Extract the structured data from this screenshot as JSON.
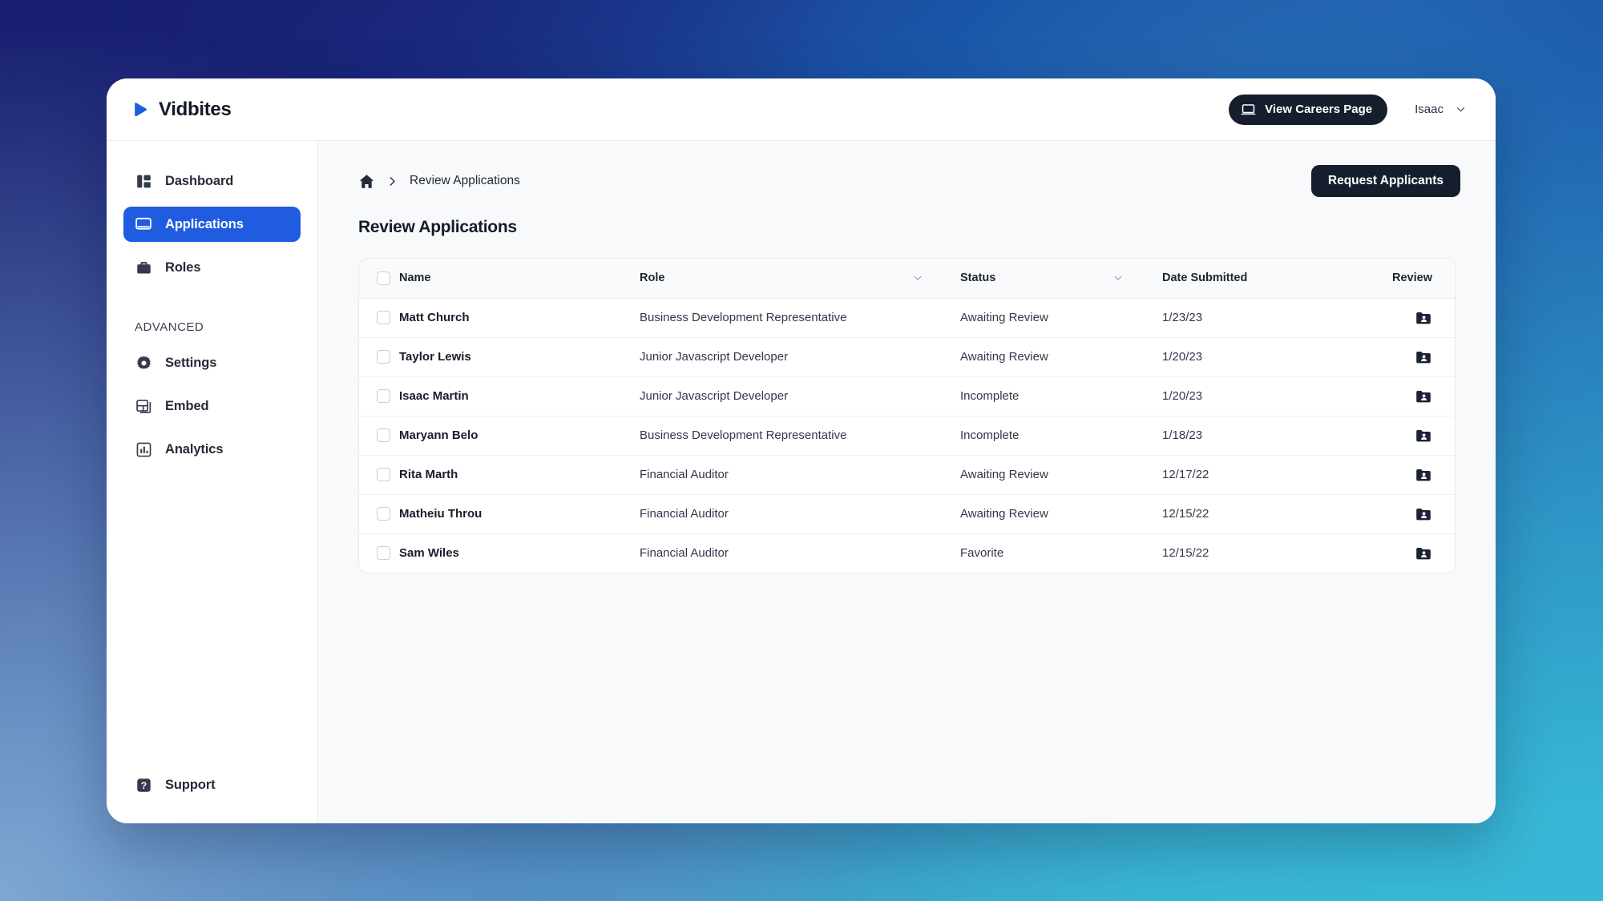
{
  "topbar": {
    "brand_name": "Vidbites",
    "careers_button": "View Careers Page",
    "user_name": "Isaac"
  },
  "sidebar": {
    "items": [
      {
        "label": "Dashboard",
        "icon": "dashboard-icon",
        "active": false
      },
      {
        "label": "Applications",
        "icon": "monitor-icon",
        "active": true
      },
      {
        "label": "Roles",
        "icon": "briefcase-icon",
        "active": false
      }
    ],
    "section_title": "ADVANCED",
    "advanced_items": [
      {
        "label": "Settings",
        "icon": "gear-icon"
      },
      {
        "label": "Embed",
        "icon": "embed-icon"
      },
      {
        "label": "Analytics",
        "icon": "bar-chart-icon"
      }
    ],
    "support_label": "Support"
  },
  "main": {
    "breadcrumb_home": "home-icon",
    "breadcrumb_current": "Review Applications",
    "request_button": "Request Applicants",
    "page_title": "Review Applications"
  },
  "table": {
    "columns": {
      "name": "Name",
      "role": "Role",
      "status": "Status",
      "date": "Date Submitted",
      "review": "Review"
    },
    "rows": [
      {
        "name": "Matt Church",
        "role": "Business Development Representative",
        "status": "Awaiting Review",
        "date": "1/23/23"
      },
      {
        "name": "Taylor Lewis",
        "role": "Junior Javascript Developer",
        "status": "Awaiting Review",
        "date": "1/20/23"
      },
      {
        "name": "Isaac Martin",
        "role": "Junior Javascript Developer",
        "status": "Incomplete",
        "date": "1/20/23"
      },
      {
        "name": "Maryann Belo",
        "role": "Business Development Representative",
        "status": "Incomplete",
        "date": "1/18/23"
      },
      {
        "name": "Rita Marth",
        "role": "Financial Auditor",
        "status": "Awaiting Review",
        "date": "12/17/22"
      },
      {
        "name": "Matheiu Throu",
        "role": "Financial Auditor",
        "status": "Awaiting Review",
        "date": "12/15/22"
      },
      {
        "name": "Sam Wiles",
        "role": "Financial Auditor",
        "status": "Favorite",
        "date": "12/15/22"
      }
    ]
  },
  "colors": {
    "accent_blue": "#1f5ce0",
    "dark_button": "#161e2e",
    "logo_blue": "#1f5ce0",
    "gradient_top_left": "#1b2270",
    "gradient_top_right": "#1b57a8",
    "gradient_bottom_left": "#84acd4",
    "gradient_bottom_right": "#38bcd8"
  }
}
